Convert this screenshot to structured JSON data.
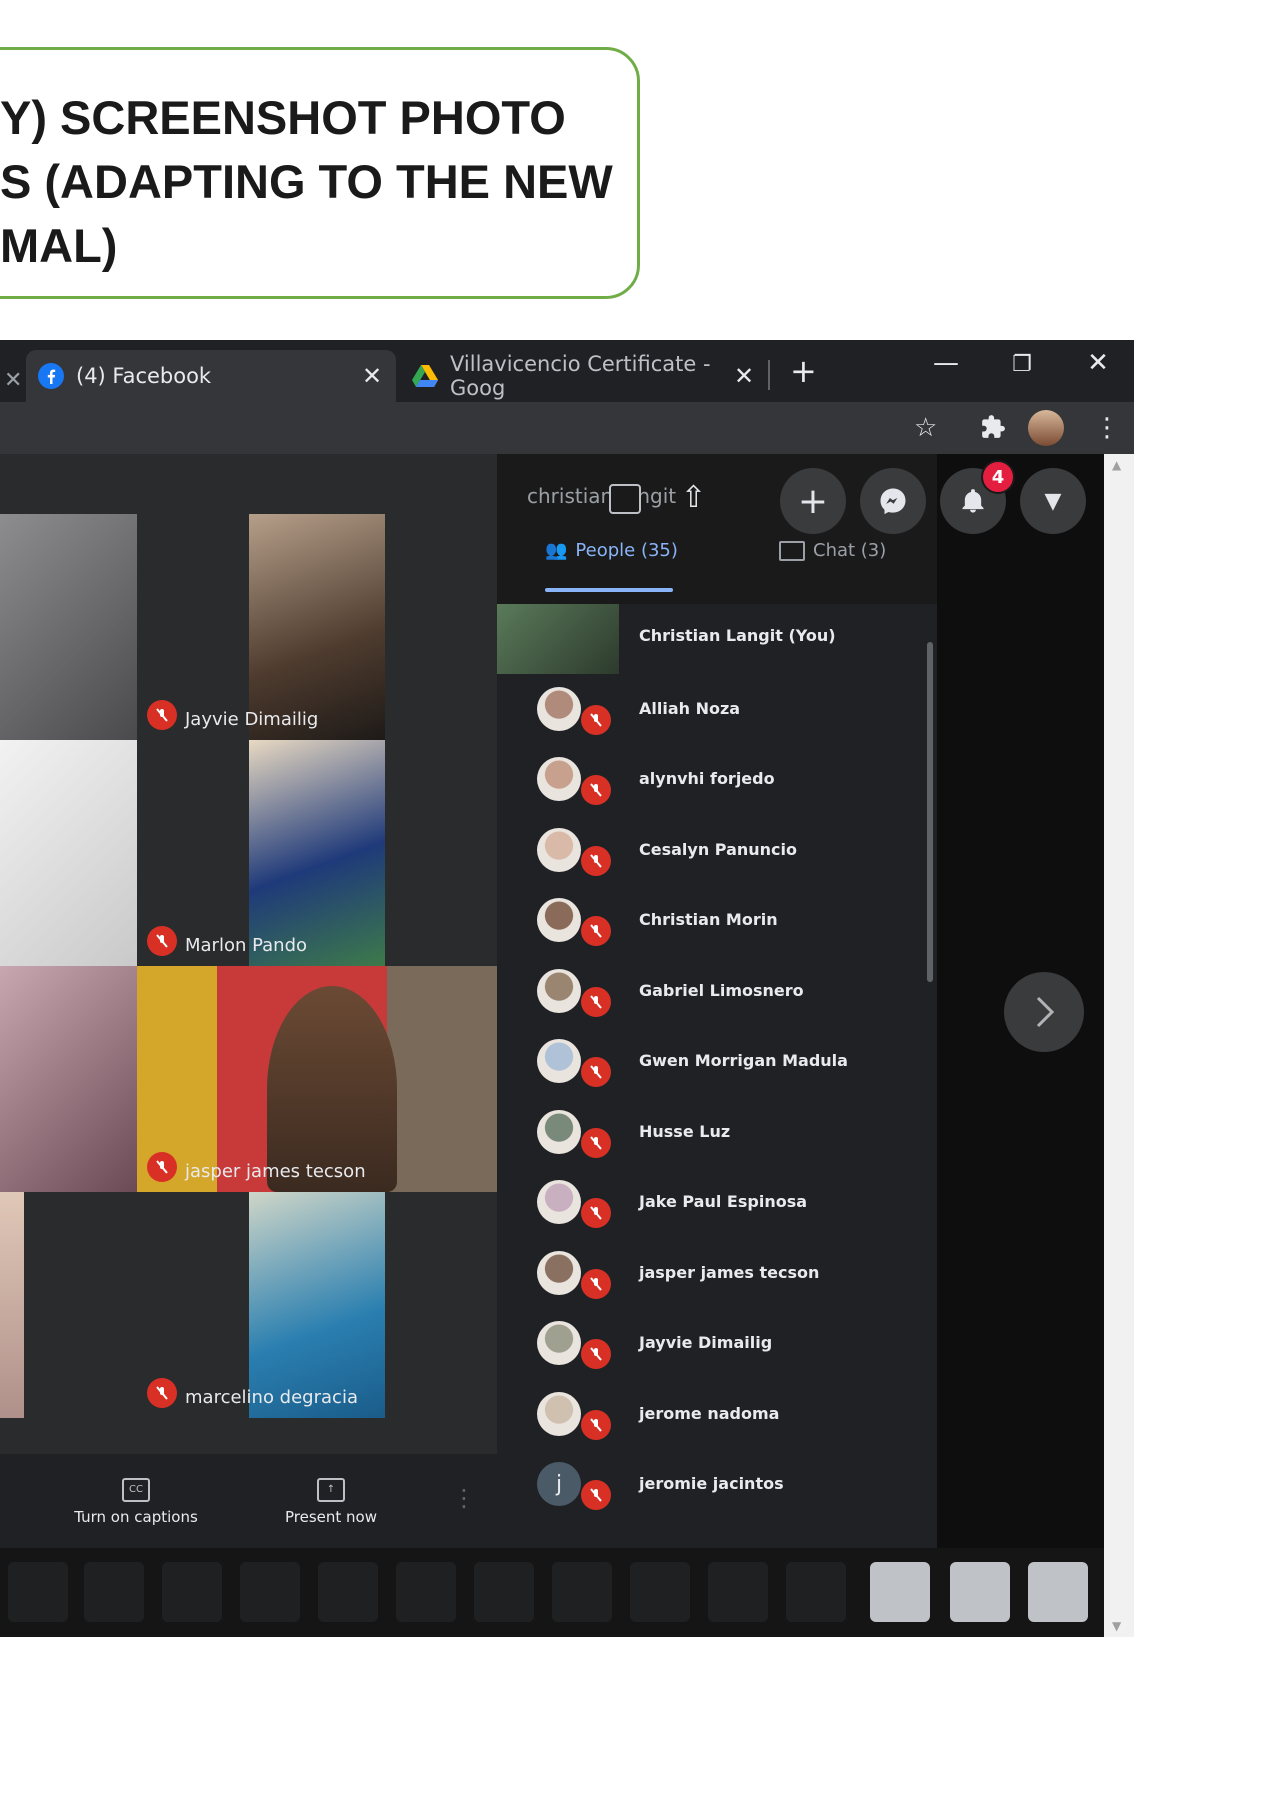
{
  "heading": {
    "lines": [
      "Y) SCREENSHOT PHOTO",
      "S (ADAPTING TO THE NEW",
      "MAL)"
    ]
  },
  "browser": {
    "tabs": [
      {
        "label": "(4) Facebook",
        "icon": "facebook-icon"
      },
      {
        "label": "Villavicencio Certificate - Goog",
        "icon": "google-drive-icon"
      }
    ],
    "new_tab_label": "+",
    "window_controls": [
      "minimize",
      "restore",
      "close"
    ]
  },
  "facebook_overlay": {
    "username": "christian langit",
    "notifications_count": "4"
  },
  "meet": {
    "tiles": [
      {
        "name": "Jayvie Dimailig"
      },
      {
        "name": "Marlon Pando"
      },
      {
        "name": "jasper james tecson"
      },
      {
        "name": "marcelino degracia"
      }
    ],
    "controls": {
      "captions_label": "Turn on captions",
      "present_label": "Present now"
    },
    "panel": {
      "people_tab": "People (35)",
      "chat_tab": "Chat (3)",
      "participants": [
        "Christian Langit (You)",
        "Alliah Noza",
        "alynvhi forjedo",
        "Cesalyn Panuncio",
        "Christian Morin",
        "Gabriel Limosnero",
        "Gwen Morrigan Madula",
        "Husse Luz",
        "Jake Paul Espinosa",
        "jasper james tecson",
        "Jayvie Dimailig",
        "jerome nadoma",
        "jeromie jacintos"
      ],
      "last_avatar_initial": "j"
    }
  },
  "colors": {
    "box_border": "#70ad47",
    "mute_red": "#d93025",
    "accent_blue": "#8ab4f8",
    "badge_red": "#e41e3f"
  }
}
